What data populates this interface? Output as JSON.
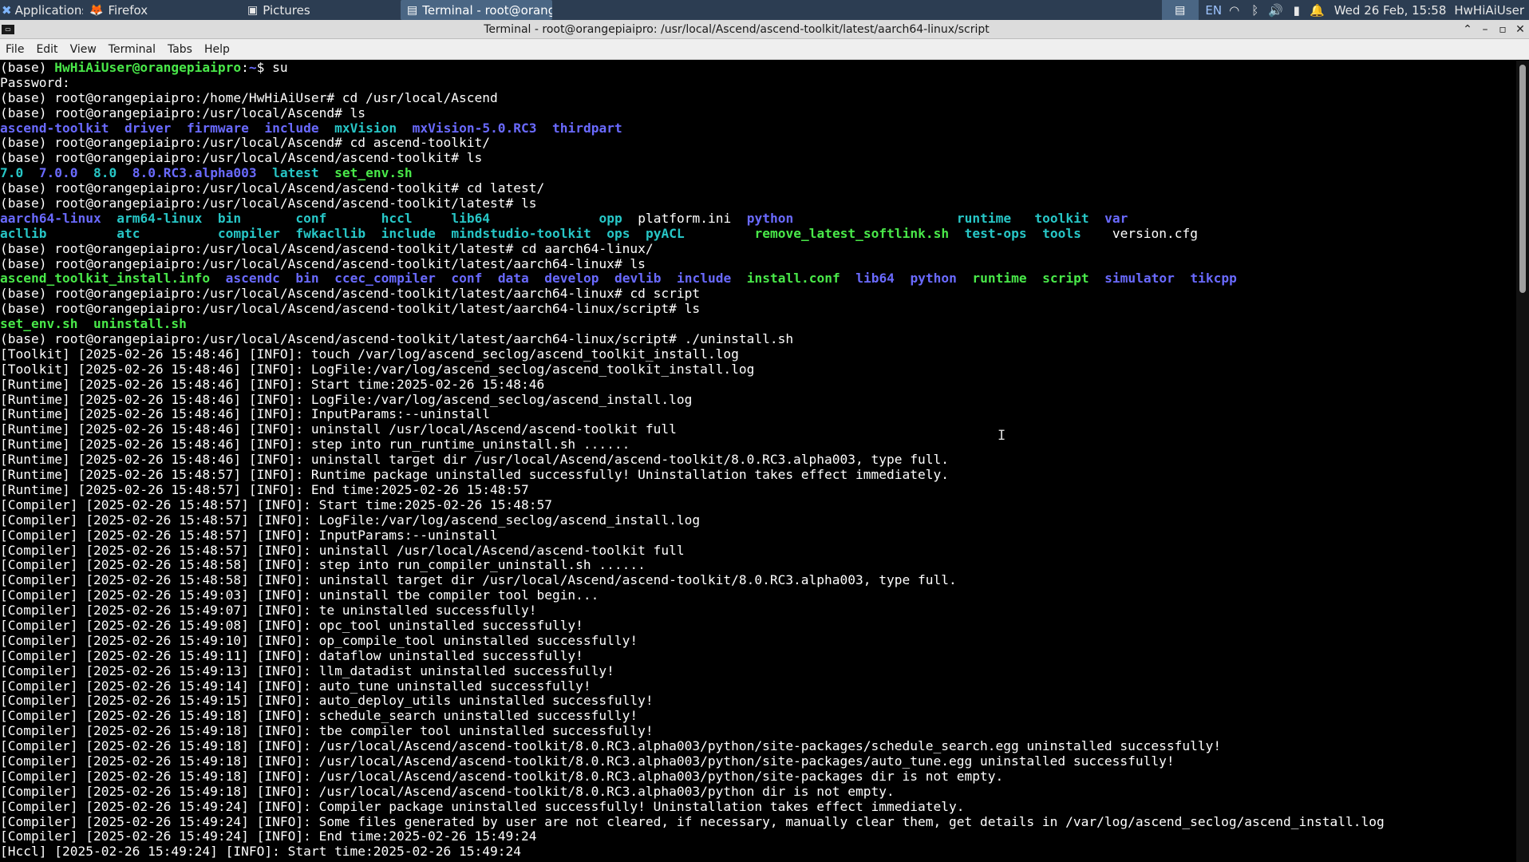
{
  "panel": {
    "applications_label": "Applications",
    "taskbar": [
      {
        "label": "Firefox",
        "icon": "firefox-icon",
        "glyph": "🦊",
        "active": false
      },
      {
        "label": "Pictures",
        "icon": "folder-icon",
        "glyph": "▣",
        "active": false
      },
      {
        "label": "Terminal - root@orange...",
        "icon": "terminal-icon",
        "glyph": "▤",
        "active": true
      }
    ],
    "tray": {
      "language": "EN",
      "clock": "Wed 26 Feb, 15:58",
      "user": "HwHiAiUser"
    }
  },
  "window": {
    "title": "Terminal - root@orangepiaipro: /usr/local/Ascend/ascend-toolkit/latest/aarch64-linux/script",
    "menus": [
      "File",
      "Edit",
      "View",
      "Terminal",
      "Tabs",
      "Help"
    ]
  },
  "colors": {
    "green": "#49e849",
    "blue": "#6a6aff",
    "cyan": "#27c6c6",
    "white": "#ffffff",
    "panel_bg": "#2c3d52"
  },
  "terminal": {
    "lines": [
      [
        {
          "t": "(base) ",
          "c": "white"
        },
        {
          "t": "HwHiAiUser@orangepiaipro",
          "c": "green"
        },
        {
          "t": ":",
          "c": "white"
        },
        {
          "t": "~",
          "c": "blue"
        },
        {
          "t": "$ su",
          "c": "white"
        }
      ],
      [
        {
          "t": "Password:",
          "c": "white"
        }
      ],
      [
        {
          "t": "(base) root@orangepiaipro:/home/HwHiAiUser# cd /usr/local/Ascend",
          "c": "white"
        }
      ],
      [
        {
          "t": "(base) root@orangepiaipro:/usr/local/Ascend# ls",
          "c": "white"
        }
      ],
      [
        {
          "t": "ascend-toolkit",
          "c": "blue"
        },
        {
          "t": "  ",
          "c": "white"
        },
        {
          "t": "driver",
          "c": "blue"
        },
        {
          "t": "  ",
          "c": "white"
        },
        {
          "t": "firmware",
          "c": "blue"
        },
        {
          "t": "  ",
          "c": "white"
        },
        {
          "t": "include",
          "c": "blue"
        },
        {
          "t": "  ",
          "c": "white"
        },
        {
          "t": "mxVision",
          "c": "cyan"
        },
        {
          "t": "  ",
          "c": "white"
        },
        {
          "t": "mxVision-5.0.RC3",
          "c": "blue"
        },
        {
          "t": "  ",
          "c": "white"
        },
        {
          "t": "thirdpart",
          "c": "blue"
        }
      ],
      [
        {
          "t": "(base) root@orangepiaipro:/usr/local/Ascend# cd ascend-toolkit/",
          "c": "white"
        }
      ],
      [
        {
          "t": "(base) root@orangepiaipro:/usr/local/Ascend/ascend-toolkit# ls",
          "c": "white"
        }
      ],
      [
        {
          "t": "7.0",
          "c": "cyan"
        },
        {
          "t": "  ",
          "c": "white"
        },
        {
          "t": "7.0.0",
          "c": "blue"
        },
        {
          "t": "  ",
          "c": "white"
        },
        {
          "t": "8.0",
          "c": "cyan"
        },
        {
          "t": "  ",
          "c": "white"
        },
        {
          "t": "8.0.RC3.alpha003",
          "c": "blue"
        },
        {
          "t": "  ",
          "c": "white"
        },
        {
          "t": "latest",
          "c": "cyan"
        },
        {
          "t": "  ",
          "c": "white"
        },
        {
          "t": "set_env.sh",
          "c": "green"
        }
      ],
      [
        {
          "t": "(base) root@orangepiaipro:/usr/local/Ascend/ascend-toolkit# cd latest/",
          "c": "white"
        }
      ],
      [
        {
          "t": "(base) root@orangepiaipro:/usr/local/Ascend/ascend-toolkit/latest# ls",
          "c": "white"
        }
      ],
      [
        {
          "t": "aarch64-linux",
          "c": "blue"
        },
        {
          "t": "  ",
          "c": "white"
        },
        {
          "t": "arm64-linux",
          "c": "cyan"
        },
        {
          "t": "  ",
          "c": "white"
        },
        {
          "t": "bin",
          "c": "cyan"
        },
        {
          "t": "       ",
          "c": "white"
        },
        {
          "t": "conf",
          "c": "cyan"
        },
        {
          "t": "       ",
          "c": "white"
        },
        {
          "t": "hccl",
          "c": "cyan"
        },
        {
          "t": "     ",
          "c": "white"
        },
        {
          "t": "lib64",
          "c": "cyan"
        },
        {
          "t": "              ",
          "c": "white"
        },
        {
          "t": "opp",
          "c": "cyan"
        },
        {
          "t": "  ",
          "c": "white"
        },
        {
          "t": "platform.ini",
          "c": "white"
        },
        {
          "t": "  ",
          "c": "white"
        },
        {
          "t": "python",
          "c": "blue"
        },
        {
          "t": "                     ",
          "c": "white"
        },
        {
          "t": "runtime",
          "c": "cyan"
        },
        {
          "t": "   ",
          "c": "white"
        },
        {
          "t": "toolkit",
          "c": "cyan"
        },
        {
          "t": "  ",
          "c": "white"
        },
        {
          "t": "var",
          "c": "blue"
        }
      ],
      [
        {
          "t": "acllib",
          "c": "cyan"
        },
        {
          "t": "         ",
          "c": "white"
        },
        {
          "t": "atc",
          "c": "cyan"
        },
        {
          "t": "          ",
          "c": "white"
        },
        {
          "t": "compiler",
          "c": "cyan"
        },
        {
          "t": "  ",
          "c": "white"
        },
        {
          "t": "fwkacllib",
          "c": "cyan"
        },
        {
          "t": "  ",
          "c": "white"
        },
        {
          "t": "include",
          "c": "cyan"
        },
        {
          "t": "  ",
          "c": "white"
        },
        {
          "t": "mindstudio-toolkit",
          "c": "cyan"
        },
        {
          "t": "  ",
          "c": "white"
        },
        {
          "t": "ops",
          "c": "cyan"
        },
        {
          "t": "  ",
          "c": "white"
        },
        {
          "t": "pyACL",
          "c": "cyan"
        },
        {
          "t": "         ",
          "c": "white"
        },
        {
          "t": "remove_latest_softlink.sh",
          "c": "green"
        },
        {
          "t": "  ",
          "c": "white"
        },
        {
          "t": "test-ops",
          "c": "cyan"
        },
        {
          "t": "  ",
          "c": "white"
        },
        {
          "t": "tools",
          "c": "cyan"
        },
        {
          "t": "    ",
          "c": "white"
        },
        {
          "t": "version.cfg",
          "c": "white"
        }
      ],
      [
        {
          "t": "(base) root@orangepiaipro:/usr/local/Ascend/ascend-toolkit/latest# cd aarch64-linux/",
          "c": "white"
        }
      ],
      [
        {
          "t": "(base) root@orangepiaipro:/usr/local/Ascend/ascend-toolkit/latest/aarch64-linux# ls",
          "c": "white"
        }
      ],
      [
        {
          "t": "ascend_toolkit_install.info",
          "c": "green"
        },
        {
          "t": "  ",
          "c": "white"
        },
        {
          "t": "ascendc",
          "c": "blue"
        },
        {
          "t": "  ",
          "c": "white"
        },
        {
          "t": "bin",
          "c": "blue"
        },
        {
          "t": "  ",
          "c": "white"
        },
        {
          "t": "ccec_compiler",
          "c": "blue"
        },
        {
          "t": "  ",
          "c": "white"
        },
        {
          "t": "conf",
          "c": "blue"
        },
        {
          "t": "  ",
          "c": "white"
        },
        {
          "t": "data",
          "c": "blue"
        },
        {
          "t": "  ",
          "c": "white"
        },
        {
          "t": "develop",
          "c": "blue"
        },
        {
          "t": "  ",
          "c": "white"
        },
        {
          "t": "devlib",
          "c": "blue"
        },
        {
          "t": "  ",
          "c": "white"
        },
        {
          "t": "include",
          "c": "blue"
        },
        {
          "t": "  ",
          "c": "white"
        },
        {
          "t": "install.conf",
          "c": "green"
        },
        {
          "t": "  ",
          "c": "white"
        },
        {
          "t": "lib64",
          "c": "blue"
        },
        {
          "t": "  ",
          "c": "white"
        },
        {
          "t": "python",
          "c": "blue"
        },
        {
          "t": "  ",
          "c": "white"
        },
        {
          "t": "runtime",
          "c": "green"
        },
        {
          "t": "  ",
          "c": "white"
        },
        {
          "t": "script",
          "c": "green"
        },
        {
          "t": "  ",
          "c": "white"
        },
        {
          "t": "simulator",
          "c": "blue"
        },
        {
          "t": "  ",
          "c": "white"
        },
        {
          "t": "tikcpp",
          "c": "blue"
        }
      ],
      [
        {
          "t": "(base) root@orangepiaipro:/usr/local/Ascend/ascend-toolkit/latest/aarch64-linux# cd script",
          "c": "white"
        }
      ],
      [
        {
          "t": "(base) root@orangepiaipro:/usr/local/Ascend/ascend-toolkit/latest/aarch64-linux/script# ls",
          "c": "white"
        }
      ],
      [
        {
          "t": "set_env.sh",
          "c": "green"
        },
        {
          "t": "  ",
          "c": "white"
        },
        {
          "t": "uninstall.sh",
          "c": "green"
        }
      ],
      [
        {
          "t": "(base) root@orangepiaipro:/usr/local/Ascend/ascend-toolkit/latest/aarch64-linux/script# ./uninstall.sh",
          "c": "white"
        }
      ],
      [
        {
          "t": "[Toolkit] [2025-02-26 15:48:46] [INFO]: touch /var/log/ascend_seclog/ascend_toolkit_install.log",
          "c": "white"
        }
      ],
      [
        {
          "t": "[Toolkit] [2025-02-26 15:48:46] [INFO]: LogFile:/var/log/ascend_seclog/ascend_toolkit_install.log",
          "c": "white"
        }
      ],
      [
        {
          "t": "[Runtime] [2025-02-26 15:48:46] [INFO]: Start time:2025-02-26 15:48:46",
          "c": "white"
        }
      ],
      [
        {
          "t": "[Runtime] [2025-02-26 15:48:46] [INFO]: LogFile:/var/log/ascend_seclog/ascend_install.log",
          "c": "white"
        }
      ],
      [
        {
          "t": "[Runtime] [2025-02-26 15:48:46] [INFO]: InputParams:--uninstall",
          "c": "white"
        }
      ],
      [
        {
          "t": "[Runtime] [2025-02-26 15:48:46] [INFO]: uninstall /usr/local/Ascend/ascend-toolkit full",
          "c": "white"
        }
      ],
      [
        {
          "t": "[Runtime] [2025-02-26 15:48:46] [INFO]: step into run_runtime_uninstall.sh ......",
          "c": "white"
        }
      ],
      [
        {
          "t": "[Runtime] [2025-02-26 15:48:46] [INFO]: uninstall target dir /usr/local/Ascend/ascend-toolkit/8.0.RC3.alpha003, type full.",
          "c": "white"
        }
      ],
      [
        {
          "t": "[Runtime] [2025-02-26 15:48:57] [INFO]: Runtime package uninstalled successfully! Uninstallation takes effect immediately.",
          "c": "white"
        }
      ],
      [
        {
          "t": "[Runtime] [2025-02-26 15:48:57] [INFO]: End time:2025-02-26 15:48:57",
          "c": "white"
        }
      ],
      [
        {
          "t": "[Compiler] [2025-02-26 15:48:57] [INFO]: Start time:2025-02-26 15:48:57",
          "c": "white"
        }
      ],
      [
        {
          "t": "[Compiler] [2025-02-26 15:48:57] [INFO]: LogFile:/var/log/ascend_seclog/ascend_install.log",
          "c": "white"
        }
      ],
      [
        {
          "t": "[Compiler] [2025-02-26 15:48:57] [INFO]: InputParams:--uninstall",
          "c": "white"
        }
      ],
      [
        {
          "t": "[Compiler] [2025-02-26 15:48:57] [INFO]: uninstall /usr/local/Ascend/ascend-toolkit full",
          "c": "white"
        }
      ],
      [
        {
          "t": "[Compiler] [2025-02-26 15:48:58] [INFO]: step into run_compiler_uninstall.sh ......",
          "c": "white"
        }
      ],
      [
        {
          "t": "[Compiler] [2025-02-26 15:48:58] [INFO]: uninstall target dir /usr/local/Ascend/ascend-toolkit/8.0.RC3.alpha003, type full.",
          "c": "white"
        }
      ],
      [
        {
          "t": "[Compiler] [2025-02-26 15:49:03] [INFO]: uninstall tbe compiler tool begin...",
          "c": "white"
        }
      ],
      [
        {
          "t": "[Compiler] [2025-02-26 15:49:07] [INFO]: te uninstalled successfully!",
          "c": "white"
        }
      ],
      [
        {
          "t": "[Compiler] [2025-02-26 15:49:08] [INFO]: opc_tool uninstalled successfully!",
          "c": "white"
        }
      ],
      [
        {
          "t": "[Compiler] [2025-02-26 15:49:10] [INFO]: op_compile_tool uninstalled successfully!",
          "c": "white"
        }
      ],
      [
        {
          "t": "[Compiler] [2025-02-26 15:49:11] [INFO]: dataflow uninstalled successfully!",
          "c": "white"
        }
      ],
      [
        {
          "t": "[Compiler] [2025-02-26 15:49:13] [INFO]: llm_datadist uninstalled successfully!",
          "c": "white"
        }
      ],
      [
        {
          "t": "[Compiler] [2025-02-26 15:49:14] [INFO]: auto_tune uninstalled successfully!",
          "c": "white"
        }
      ],
      [
        {
          "t": "[Compiler] [2025-02-26 15:49:15] [INFO]: auto_deploy_utils uninstalled successfully!",
          "c": "white"
        }
      ],
      [
        {
          "t": "[Compiler] [2025-02-26 15:49:18] [INFO]: schedule_search uninstalled successfully!",
          "c": "white"
        }
      ],
      [
        {
          "t": "[Compiler] [2025-02-26 15:49:18] [INFO]: tbe compiler tool uninstalled successfully!",
          "c": "white"
        }
      ],
      [
        {
          "t": "[Compiler] [2025-02-26 15:49:18] [INFO]: /usr/local/Ascend/ascend-toolkit/8.0.RC3.alpha003/python/site-packages/schedule_search.egg uninstalled successfully!",
          "c": "white"
        }
      ],
      [
        {
          "t": "[Compiler] [2025-02-26 15:49:18] [INFO]: /usr/local/Ascend/ascend-toolkit/8.0.RC3.alpha003/python/site-packages/auto_tune.egg uninstalled successfully!",
          "c": "white"
        }
      ],
      [
        {
          "t": "[Compiler] [2025-02-26 15:49:18] [INFO]: /usr/local/Ascend/ascend-toolkit/8.0.RC3.alpha003/python/site-packages dir is not empty.",
          "c": "white"
        }
      ],
      [
        {
          "t": "[Compiler] [2025-02-26 15:49:18] [INFO]: /usr/local/Ascend/ascend-toolkit/8.0.RC3.alpha003/python dir is not empty.",
          "c": "white"
        }
      ],
      [
        {
          "t": "[Compiler] [2025-02-26 15:49:24] [INFO]: Compiler package uninstalled successfully! Uninstallation takes effect immediately.",
          "c": "white"
        }
      ],
      [
        {
          "t": "[Compiler] [2025-02-26 15:49:24] [INFO]: Some files generated by user are not cleared, if necessary, manually clear them, get details in /var/log/ascend_seclog/ascend_install.log",
          "c": "white"
        }
      ],
      [
        {
          "t": "[Compiler] [2025-02-26 15:49:24] [INFO]: End time:2025-02-26 15:49:24",
          "c": "white"
        }
      ],
      [
        {
          "t": "[Hccl] [2025-02-26 15:49:24] [INFO]: Start time:2025-02-26 15:49:24",
          "c": "white"
        }
      ]
    ]
  }
}
